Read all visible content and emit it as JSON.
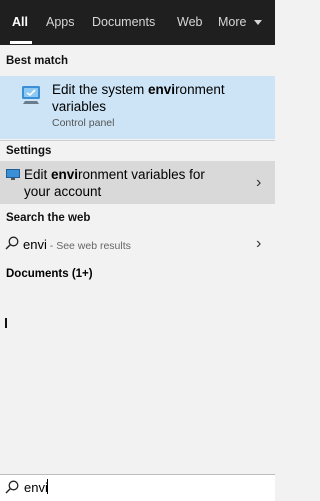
{
  "tabs": [
    {
      "label": "All"
    },
    {
      "label": "Apps"
    },
    {
      "label": "Documents"
    },
    {
      "label": "Web"
    },
    {
      "label": "More"
    }
  ],
  "sections": {
    "best_match": "Best match",
    "settings": "Settings",
    "search_web": "Search the web",
    "documents": "Documents (1+)"
  },
  "best_match": {
    "title_pre": "Edit the system ",
    "title_bold": "envi",
    "title_post": "ronment variables",
    "subtitle": "Control panel",
    "icon": "control-panel-icon"
  },
  "settings_item": {
    "title_pre": "Edit ",
    "title_bold": "envi",
    "title_post": "ronment variables for your account",
    "icon": "settings-monitor-icon"
  },
  "web_item": {
    "query": "envi",
    "hint": " - See web results"
  },
  "search": {
    "value": "envi"
  },
  "colors": {
    "topbar": "#1f1f1f",
    "highlight": "#cce4f6",
    "hover_row": "#d9d9d9"
  }
}
